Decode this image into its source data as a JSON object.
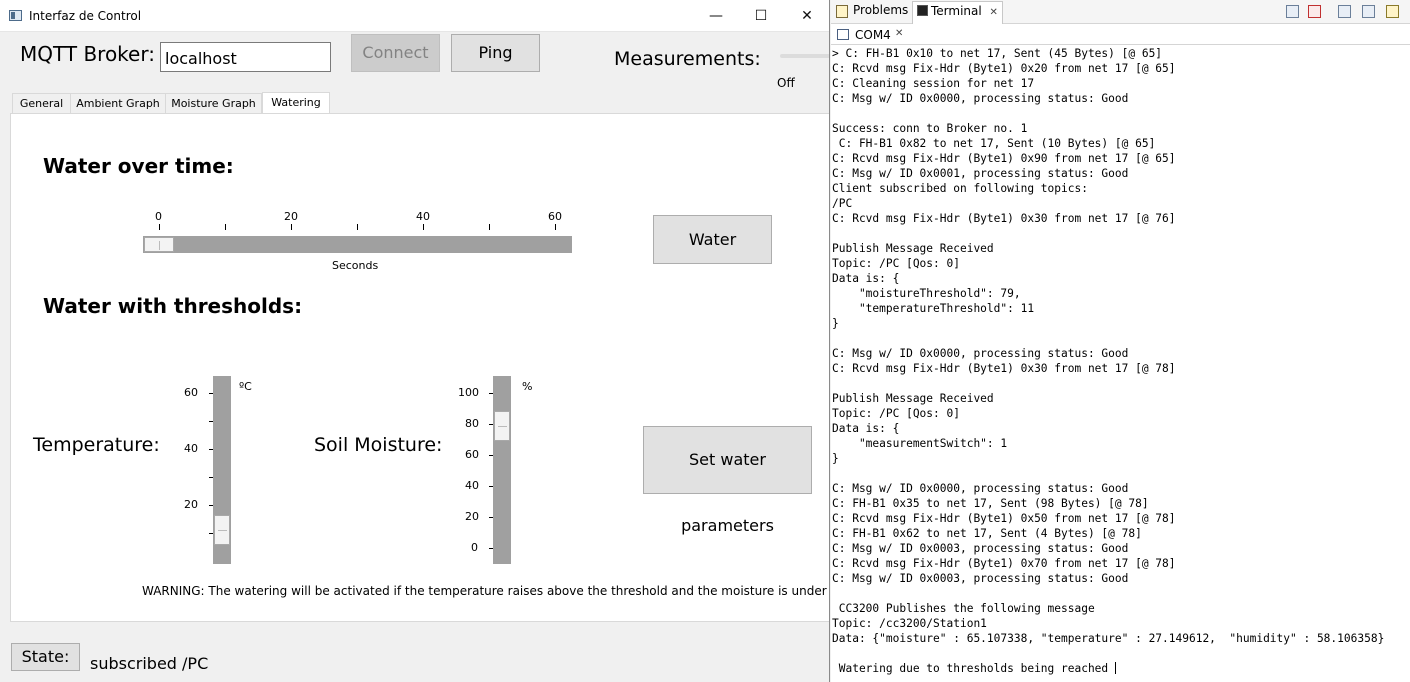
{
  "window": {
    "title": "Interfaz de Control",
    "minimize": "—",
    "maximize": "☐",
    "close": "✕"
  },
  "broker": {
    "label": "MQTT Broker:",
    "value": "localhost",
    "connect": "Connect",
    "ping": "Ping"
  },
  "measurements": {
    "label": "Measurements:",
    "off": "Off"
  },
  "tabs": [
    "General",
    "Ambient Graph",
    "Moisture Graph",
    "Watering"
  ],
  "watering": {
    "time_heading": "Water over time:",
    "time_ticks": [
      "0",
      "20",
      "40",
      "60"
    ],
    "time_unit": "Seconds",
    "time_value": 0,
    "water_button": "Water",
    "threshold_heading": "Water with thresholds:",
    "temperature_label": "Temperature:",
    "temperature_unit": "ºC",
    "temperature_ticks": [
      "60",
      "40",
      "20"
    ],
    "temperature_value": 11,
    "moisture_label": "Soil Moisture:",
    "moisture_unit": "%",
    "moisture_ticks": [
      "100",
      "80",
      "60",
      "40",
      "20",
      "0"
    ],
    "moisture_value": 79,
    "set_button": "Set water parameters",
    "warning": "WARNING: The watering will be activated if the temperature raises above the threshold and the moisture is under the threshold"
  },
  "state": {
    "label": "State:",
    "value": "subscribed /PC"
  },
  "terminal": {
    "tab_problems": "Problems",
    "tab_terminal": "Terminal",
    "tab_close": "✕",
    "subtab": "COM4",
    "lines": [
      "> C: FH-B1 0x10 to net 17, Sent (45 Bytes) [@ 65]",
      "C: Rcvd msg Fix-Hdr (Byte1) 0x20 from net 17 [@ 65]",
      "C: Cleaning session for net 17",
      "C: Msg w/ ID 0x0000, processing status: Good",
      "",
      "Success: conn to Broker no. 1",
      " C: FH-B1 0x82 to net 17, Sent (10 Bytes) [@ 65]",
      "C: Rcvd msg Fix-Hdr (Byte1) 0x90 from net 17 [@ 65]",
      "C: Msg w/ ID 0x0001, processing status: Good",
      "Client subscribed on following topics:",
      "/PC",
      "C: Rcvd msg Fix-Hdr (Byte1) 0x30 from net 17 [@ 76]",
      "",
      "Publish Message Received",
      "Topic: /PC [Qos: 0]",
      "Data is: {",
      "    \"moistureThreshold\": 79,",
      "    \"temperatureThreshold\": 11",
      "}",
      "",
      "C: Msg w/ ID 0x0000, processing status: Good",
      "C: Rcvd msg Fix-Hdr (Byte1) 0x30 from net 17 [@ 78]",
      "",
      "Publish Message Received",
      "Topic: /PC [Qos: 0]",
      "Data is: {",
      "    \"measurementSwitch\": 1",
      "}",
      "",
      "C: Msg w/ ID 0x0000, processing status: Good",
      "C: FH-B1 0x35 to net 17, Sent (98 Bytes) [@ 78]",
      "C: Rcvd msg Fix-Hdr (Byte1) 0x50 from net 17 [@ 78]",
      "C: FH-B1 0x62 to net 17, Sent (4 Bytes) [@ 78]",
      "C: Msg w/ ID 0x0003, processing status: Good",
      "C: Rcvd msg Fix-Hdr (Byte1) 0x70 from net 17 [@ 78]",
      "C: Msg w/ ID 0x0003, processing status: Good",
      "",
      " CC3200 Publishes the following message",
      "Topic: /cc3200/Station1",
      "Data: {\"moisture\" : 65.107338, \"temperature\" : 27.149612,  \"humidity\" : 58.106358}",
      "",
      " Watering due to thresholds being reached "
    ]
  }
}
